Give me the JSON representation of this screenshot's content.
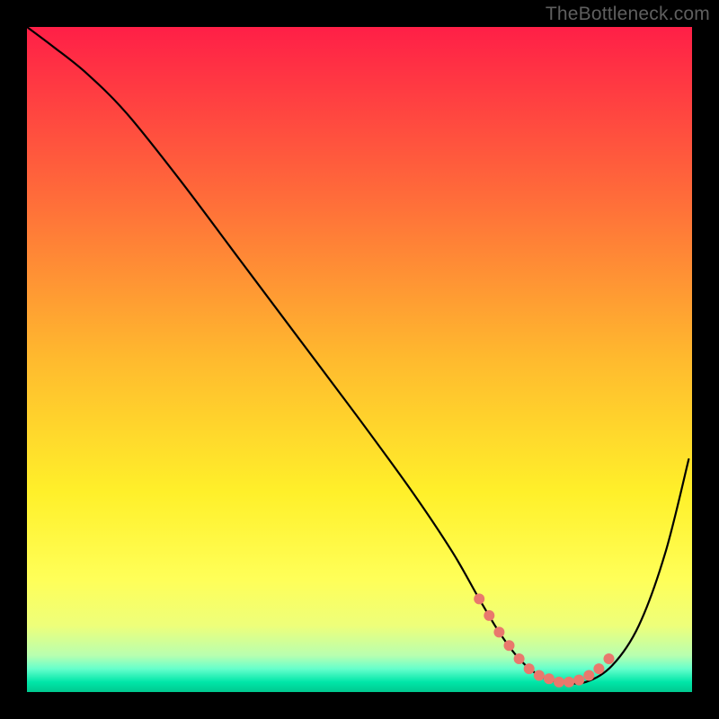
{
  "watermark": "TheBottleneck.com",
  "chart_data": {
    "type": "line",
    "title": "",
    "xlabel": "",
    "ylabel": "",
    "xlim": [
      0,
      100
    ],
    "ylim": [
      0,
      100
    ],
    "grid": false,
    "legend": false,
    "gradient_stops": [
      {
        "offset": 0,
        "color": "#ff1f47"
      },
      {
        "offset": 0.25,
        "color": "#ff6a3a"
      },
      {
        "offset": 0.5,
        "color": "#ffba2e"
      },
      {
        "offset": 0.7,
        "color": "#fff02a"
      },
      {
        "offset": 0.83,
        "color": "#ffff58"
      },
      {
        "offset": 0.9,
        "color": "#eeff7a"
      },
      {
        "offset": 0.945,
        "color": "#b8ffb0"
      },
      {
        "offset": 0.965,
        "color": "#66ffcc"
      },
      {
        "offset": 0.985,
        "color": "#00e6a8"
      },
      {
        "offset": 1.0,
        "color": "#00c88f"
      }
    ],
    "series": [
      {
        "name": "curve",
        "color": "#000000",
        "x": [
          0,
          4,
          9,
          15,
          23,
          32,
          41,
          50,
          58,
          64,
          68,
          71,
          74,
          77,
          80,
          84,
          88,
          92,
          96,
          99.5
        ],
        "y": [
          100,
          97,
          93,
          87,
          77,
          65,
          53,
          41,
          30,
          21,
          14,
          9,
          5,
          2.5,
          1.5,
          1.5,
          4,
          10,
          21,
          35
        ]
      }
    ],
    "markers": {
      "name": "valley-points",
      "color": "#e9786d",
      "radius_px": 6,
      "x": [
        68,
        69.5,
        71,
        72.5,
        74,
        75.5,
        77,
        78.5,
        80,
        81.5,
        83,
        84.5,
        86,
        87.5
      ],
      "y": [
        14,
        11.5,
        9,
        7,
        5,
        3.5,
        2.5,
        2,
        1.5,
        1.5,
        1.8,
        2.5,
        3.5,
        5
      ]
    }
  }
}
